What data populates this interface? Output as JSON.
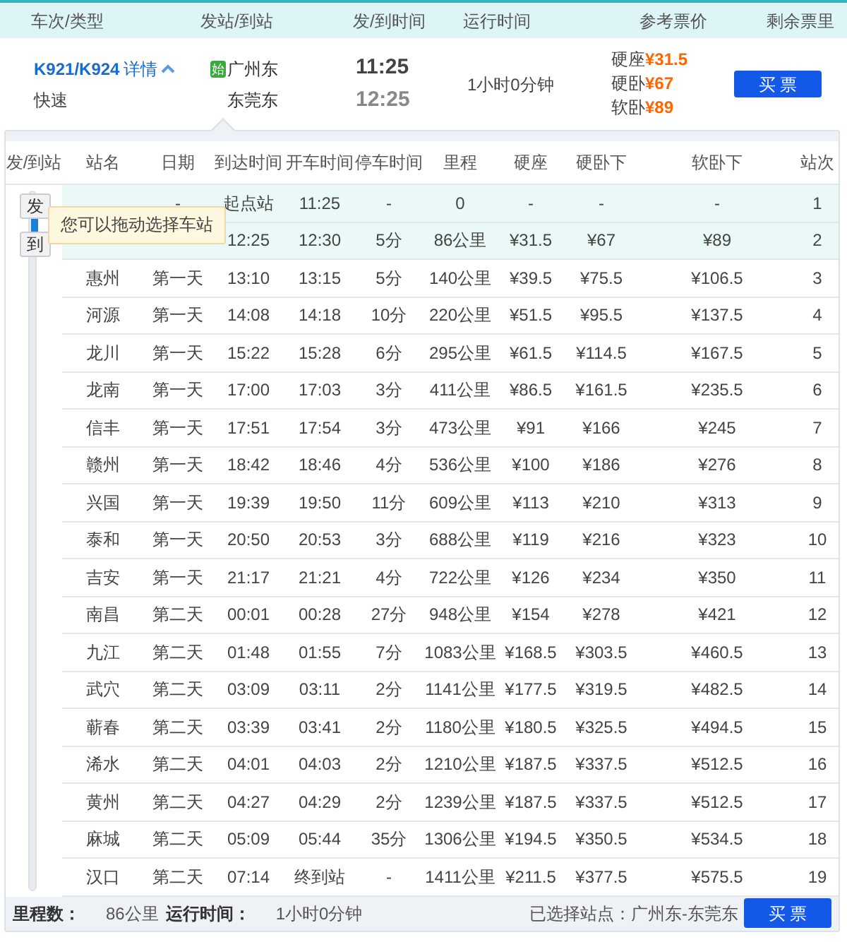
{
  "header": {
    "columns": [
      "车次/类型",
      "发站/到站",
      "发/到时间",
      "运行时间",
      "参考票价",
      "剩余票里"
    ]
  },
  "train": {
    "number": "K921/K924",
    "details_link": "详情",
    "expanded": true,
    "type": "快速",
    "from_badge": "始",
    "from_station": "广州东",
    "to_station": "东莞东",
    "depart": "11:25",
    "arrive": "12:25",
    "duration": "1小时0分钟",
    "prices": [
      {
        "seat": "硬座",
        "price": "¥31.5"
      },
      {
        "seat": "硬卧",
        "price": "¥67"
      },
      {
        "seat": "软卧",
        "price": "¥89"
      }
    ],
    "buy_button": "买 票"
  },
  "detail": {
    "columns": [
      "发/到站",
      "站名",
      "日期",
      "到达时间",
      "开车时间",
      "停车时间",
      "里程",
      "硬座",
      "硬卧下",
      "软卧下",
      "站次"
    ],
    "slider": {
      "from_label": "发",
      "to_label": "到"
    },
    "tooltip": "您可以拖动选择车站",
    "rows": [
      {
        "day": "-",
        "arrive": "起点站",
        "depart": "11:25",
        "stop": "-",
        "distance": "0",
        "hard_seat": "-",
        "hard_sleeper": "-",
        "soft_sleeper": "-",
        "index": "1",
        "selected": true
      },
      {
        "arrive": "12:25",
        "depart": "12:30",
        "stop": "5分",
        "distance": "86公里",
        "hard_seat": "¥31.5",
        "hard_sleeper": "¥67",
        "soft_sleeper": "¥89",
        "index": "2",
        "selected": true
      },
      {
        "station": "惠州",
        "day": "第一天",
        "arrive": "13:10",
        "depart": "13:15",
        "stop": "5分",
        "distance": "140公里",
        "hard_seat": "¥39.5",
        "hard_sleeper": "¥75.5",
        "soft_sleeper": "¥106.5",
        "index": "3",
        "selected": false
      },
      {
        "station": "河源",
        "day": "第一天",
        "arrive": "14:08",
        "depart": "14:18",
        "stop": "10分",
        "distance": "220公里",
        "hard_seat": "¥51.5",
        "hard_sleeper": "¥95.5",
        "soft_sleeper": "¥137.5",
        "index": "4",
        "selected": false
      },
      {
        "station": "龙川",
        "day": "第一天",
        "arrive": "15:22",
        "depart": "15:28",
        "stop": "6分",
        "distance": "295公里",
        "hard_seat": "¥61.5",
        "hard_sleeper": "¥114.5",
        "soft_sleeper": "¥167.5",
        "index": "5",
        "selected": false
      },
      {
        "station": "龙南",
        "day": "第一天",
        "arrive": "17:00",
        "depart": "17:03",
        "stop": "3分",
        "distance": "411公里",
        "hard_seat": "¥86.5",
        "hard_sleeper": "¥161.5",
        "soft_sleeper": "¥235.5",
        "index": "6",
        "selected": false
      },
      {
        "station": "信丰",
        "day": "第一天",
        "arrive": "17:51",
        "depart": "17:54",
        "stop": "3分",
        "distance": "473公里",
        "hard_seat": "¥91",
        "hard_sleeper": "¥166",
        "soft_sleeper": "¥245",
        "index": "7",
        "selected": false
      },
      {
        "station": "赣州",
        "day": "第一天",
        "arrive": "18:42",
        "depart": "18:46",
        "stop": "4分",
        "distance": "536公里",
        "hard_seat": "¥100",
        "hard_sleeper": "¥186",
        "soft_sleeper": "¥276",
        "index": "8",
        "selected": false
      },
      {
        "station": "兴国",
        "day": "第一天",
        "arrive": "19:39",
        "depart": "19:50",
        "stop": "11分",
        "distance": "609公里",
        "hard_seat": "¥113",
        "hard_sleeper": "¥210",
        "soft_sleeper": "¥313",
        "index": "9",
        "selected": false
      },
      {
        "station": "泰和",
        "day": "第一天",
        "arrive": "20:50",
        "depart": "20:53",
        "stop": "3分",
        "distance": "688公里",
        "hard_seat": "¥119",
        "hard_sleeper": "¥216",
        "soft_sleeper": "¥323",
        "index": "10",
        "selected": false
      },
      {
        "station": "吉安",
        "day": "第一天",
        "arrive": "21:17",
        "depart": "21:21",
        "stop": "4分",
        "distance": "722公里",
        "hard_seat": "¥126",
        "hard_sleeper": "¥234",
        "soft_sleeper": "¥350",
        "index": "11",
        "selected": false
      },
      {
        "station": "南昌",
        "day": "第二天",
        "arrive": "00:01",
        "depart": "00:28",
        "stop": "27分",
        "distance": "948公里",
        "hard_seat": "¥154",
        "hard_sleeper": "¥278",
        "soft_sleeper": "¥421",
        "index": "12",
        "selected": false
      },
      {
        "station": "九江",
        "day": "第二天",
        "arrive": "01:48",
        "depart": "01:55",
        "stop": "7分",
        "distance": "1083公里",
        "hard_seat": "¥168.5",
        "hard_sleeper": "¥303.5",
        "soft_sleeper": "¥460.5",
        "index": "13",
        "selected": false
      },
      {
        "station": "武穴",
        "day": "第二天",
        "arrive": "03:09",
        "depart": "03:11",
        "stop": "2分",
        "distance": "1141公里",
        "hard_seat": "¥177.5",
        "hard_sleeper": "¥319.5",
        "soft_sleeper": "¥482.5",
        "index": "14",
        "selected": false
      },
      {
        "station": "蕲春",
        "day": "第二天",
        "arrive": "03:39",
        "depart": "03:41",
        "stop": "2分",
        "distance": "1180公里",
        "hard_seat": "¥180.5",
        "hard_sleeper": "¥325.5",
        "soft_sleeper": "¥494.5",
        "index": "15",
        "selected": false
      },
      {
        "station": "浠水",
        "day": "第二天",
        "arrive": "04:01",
        "depart": "04:03",
        "stop": "2分",
        "distance": "1210公里",
        "hard_seat": "¥187.5",
        "hard_sleeper": "¥337.5",
        "soft_sleeper": "¥512.5",
        "index": "16",
        "selected": false
      },
      {
        "station": "黄州",
        "day": "第二天",
        "arrive": "04:27",
        "depart": "04:29",
        "stop": "2分",
        "distance": "1239公里",
        "hard_seat": "¥187.5",
        "hard_sleeper": "¥337.5",
        "soft_sleeper": "¥512.5",
        "index": "17",
        "selected": false
      },
      {
        "station": "麻城",
        "day": "第二天",
        "arrive": "05:09",
        "depart": "05:44",
        "stop": "35分",
        "distance": "1306公里",
        "hard_seat": "¥194.5",
        "hard_sleeper": "¥350.5",
        "soft_sleeper": "¥534.5",
        "index": "18",
        "selected": false
      },
      {
        "station": "汉口",
        "day": "第二天",
        "arrive": "07:14",
        "depart": "终到站",
        "stop": "-",
        "distance": "1411公里",
        "hard_seat": "¥211.5",
        "hard_sleeper": "¥377.5",
        "soft_sleeper": "¥575.5",
        "index": "19",
        "selected": false
      }
    ]
  },
  "footer": {
    "distance_label": "里程数：",
    "distance": "86公里",
    "duration_label": "运行时间：",
    "duration": "1小时0分钟",
    "selected_stations": "已选择站点：广州东-东莞东",
    "buy_button": "买 票"
  }
}
